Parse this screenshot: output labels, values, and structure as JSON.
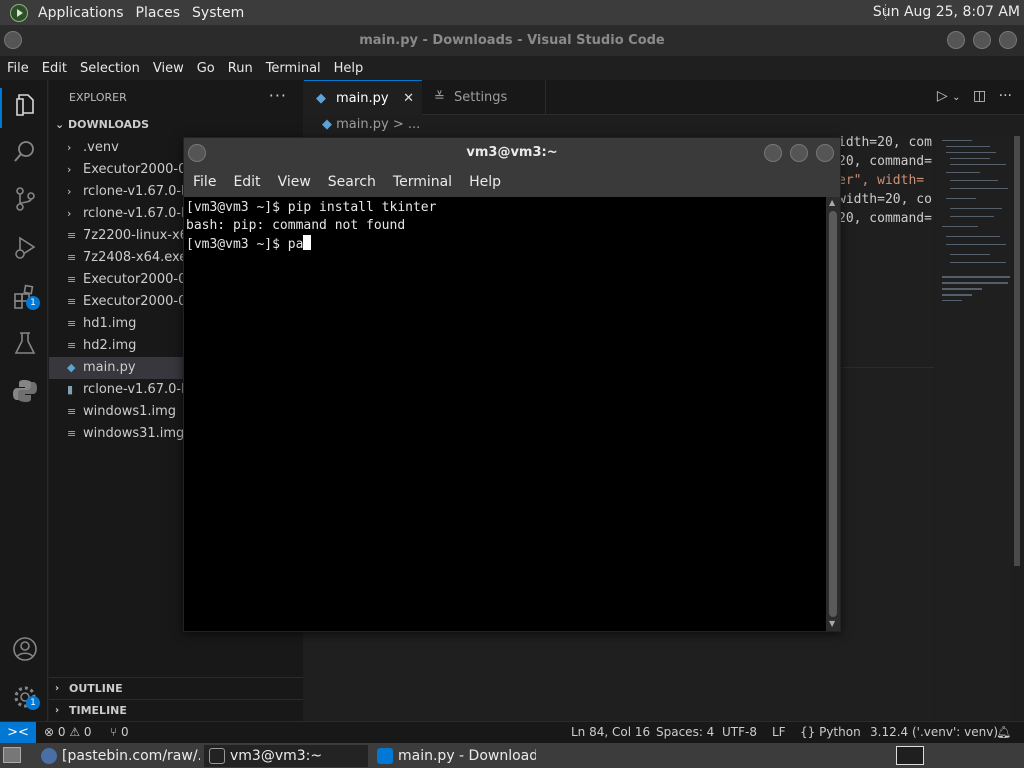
{
  "top_panel": {
    "menus": [
      "Applications",
      "Places",
      "System"
    ],
    "clock": "Sun Aug 25,  8:07 AM"
  },
  "vscode": {
    "window_title": "main.py - Downloads - Visual Studio Code",
    "menu": [
      "File",
      "Edit",
      "Selection",
      "View",
      "Go",
      "Run",
      "Terminal",
      "Help"
    ],
    "activity_badges": {
      "extensions": "1",
      "settings": "1"
    },
    "sidebar": {
      "title": "EXPLORER",
      "more": "···",
      "section": "DOWNLOADS",
      "items": [
        {
          "label": ".venv",
          "type": "folder"
        },
        {
          "label": "Executor2000-0.",
          "type": "folder"
        },
        {
          "label": "rclone-v1.67.0-lin",
          "type": "folder"
        },
        {
          "label": "rclone-v1.67.0-lin",
          "type": "folder"
        },
        {
          "label": "7z2200-linux-x64",
          "type": "file"
        },
        {
          "label": "7z2408-x64.exe",
          "type": "file"
        },
        {
          "label": "Executor2000-0.",
          "type": "file"
        },
        {
          "label": "Executor2000-0.",
          "type": "file"
        },
        {
          "label": "hd1.img",
          "type": "file"
        },
        {
          "label": "hd2.img",
          "type": "file"
        },
        {
          "label": "main.py",
          "type": "python",
          "selected": true
        },
        {
          "label": "rclone-v1.67.0-lin",
          "type": "archive"
        },
        {
          "label": "windows1.img",
          "type": "file"
        },
        {
          "label": "windows31.img",
          "type": "file"
        }
      ],
      "outline": "OUTLINE",
      "timeline": "TIMELINE"
    },
    "tabs": [
      {
        "label": "main.py",
        "active": true,
        "close": "✕"
      },
      {
        "label": "Settings",
        "active": false
      }
    ],
    "breadcrumb": "main.py > ...",
    "code_fragments": [
      "idth=20, com",
      "20, command=",
      "er\", width=",
      "width=20, co",
      "20, command="
    ],
    "statusbar": {
      "remote": "><",
      "problems": "⊗ 0 ⚠ 0",
      "ports": "⑂ 0",
      "position": "Ln 84, Col 16",
      "spaces": "Spaces: 4",
      "encoding": "UTF-8",
      "eol": "LF",
      "language": "Python",
      "interpreter": "3.12.4 ('.venv': venv)"
    }
  },
  "terminal": {
    "window_title": "vm3@vm3:~",
    "menu": [
      "File",
      "Edit",
      "View",
      "Search",
      "Terminal",
      "Help"
    ],
    "lines": [
      "[vm3@vm3 ~]$ pip install tkinter",
      "bash: pip: command not found",
      "[vm3@vm3 ~]$ pa"
    ]
  },
  "taskbar": {
    "tasks": [
      {
        "label": "[pastebin.com/raw/...",
        "icon": "browser-icon"
      },
      {
        "label": "vm3@vm3:~",
        "icon": "terminal-icon",
        "active": true
      },
      {
        "label": "main.py - Download...",
        "icon": "vscode-icon"
      }
    ]
  }
}
